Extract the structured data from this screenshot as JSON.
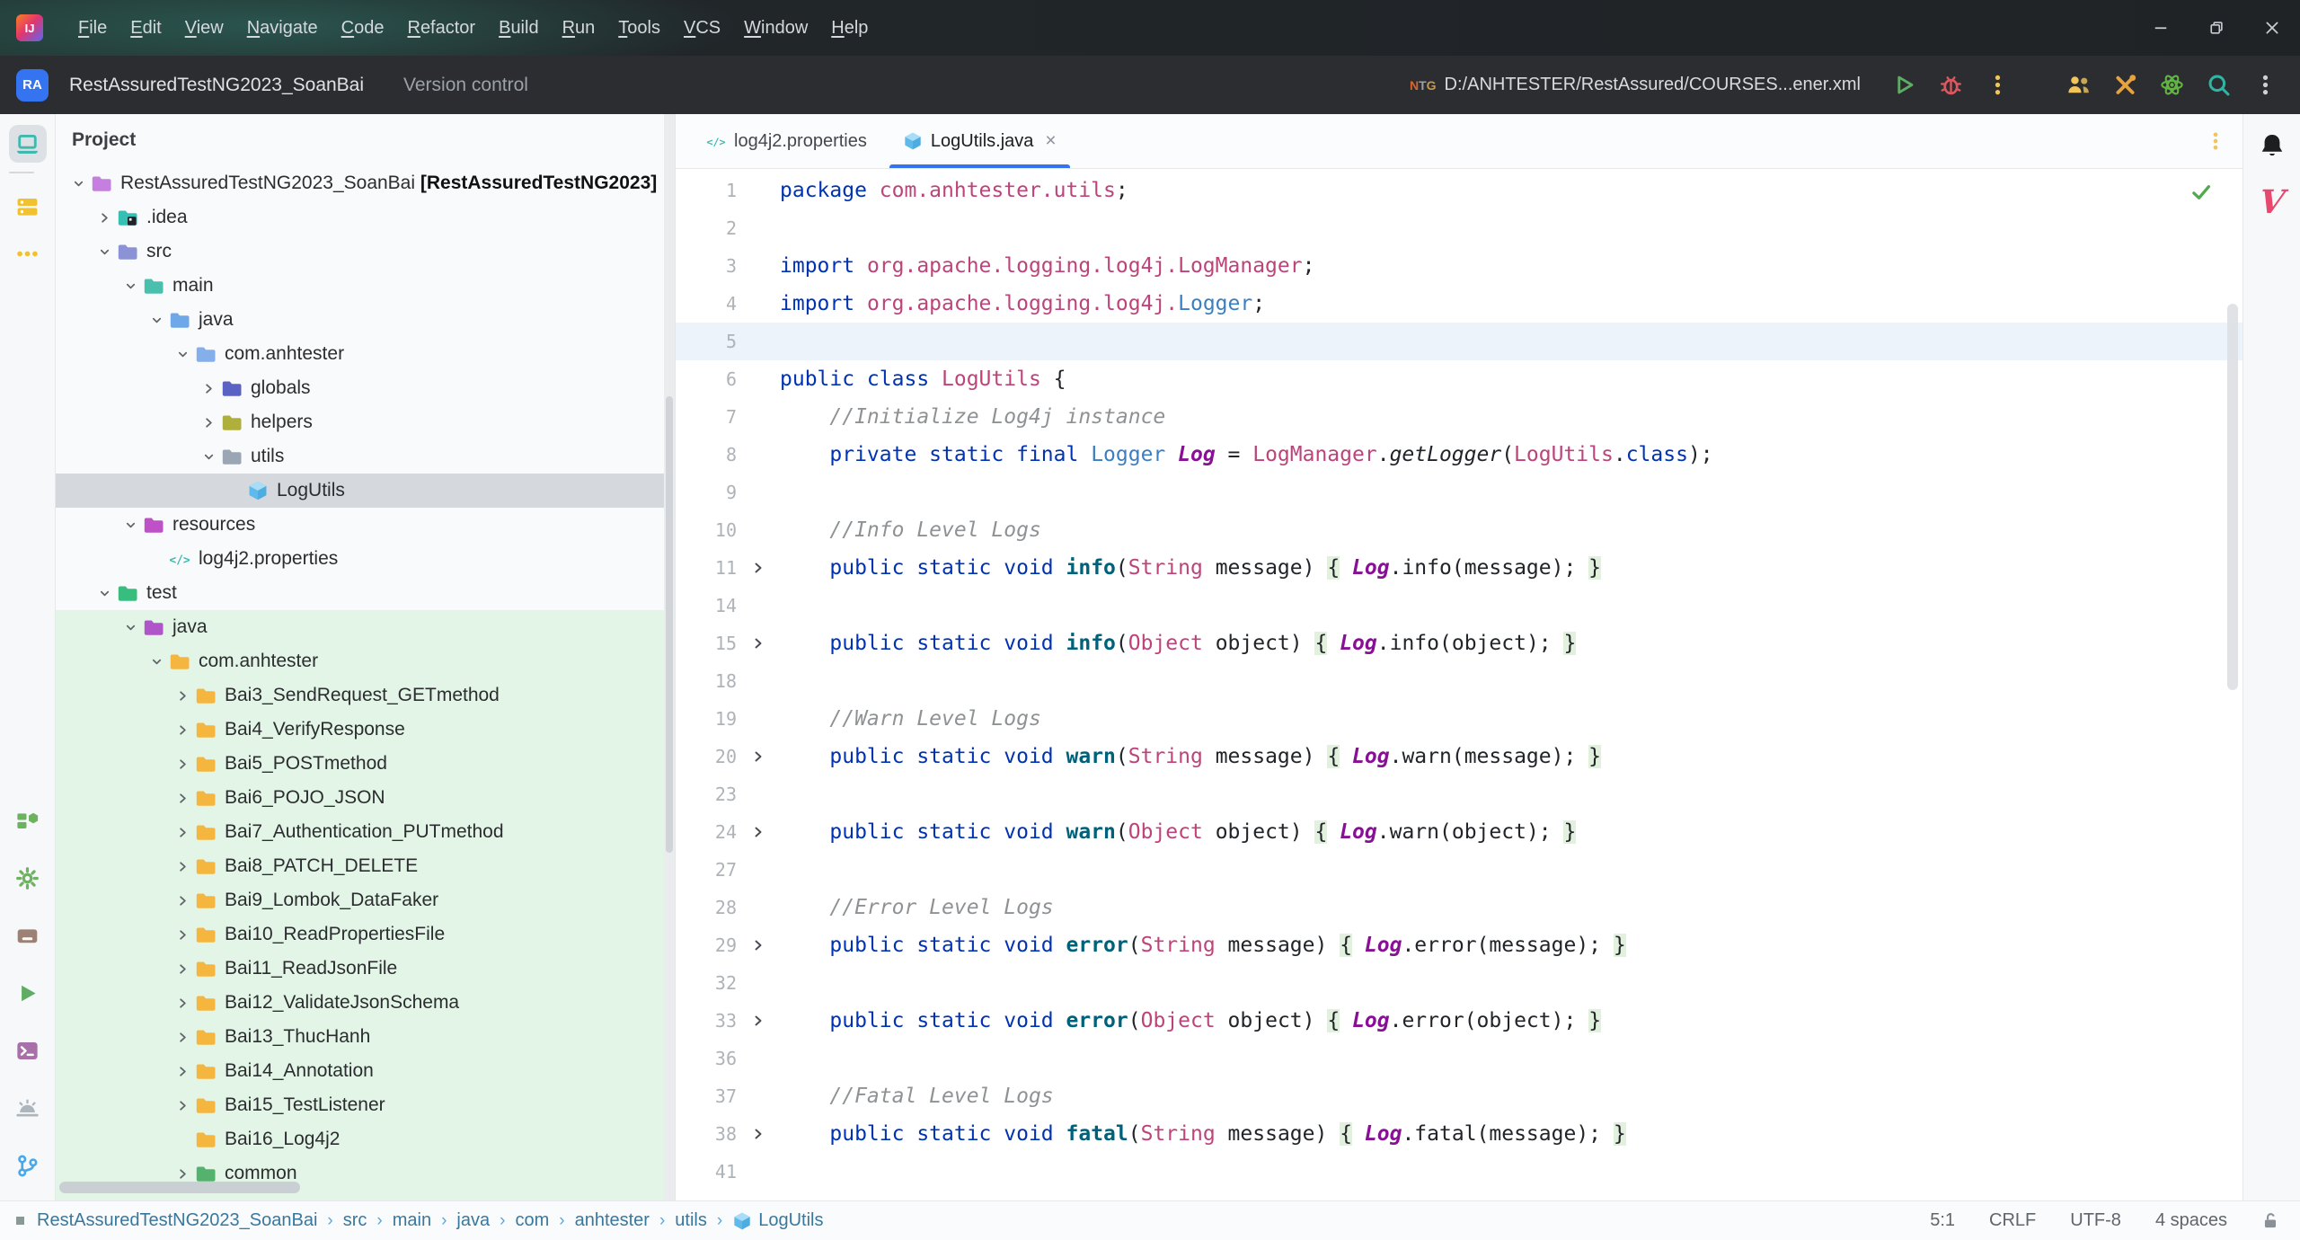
{
  "window": {
    "menus": [
      "File",
      "Edit",
      "View",
      "Navigate",
      "Code",
      "Refactor",
      "Build",
      "Run",
      "Tools",
      "VCS",
      "Window",
      "Help"
    ],
    "controls": [
      "minimize",
      "restore",
      "close"
    ],
    "logo_text": "IJ"
  },
  "toolbar": {
    "avatar": "RA",
    "project_name": "RestAssuredTestNG2023_SoanBai",
    "vcs_label": "Version control",
    "run_config": "D:/ANHTESTER/RestAssured/COURSES...ener.xml",
    "right_icons": [
      "users-icon",
      "tools-icon",
      "atom-icon",
      "search-icon",
      "kebab-icon"
    ]
  },
  "activity_bar": {
    "top": [
      {
        "name": "project-tool-icon",
        "glyph": "laptop",
        "color": "#3FB9AE",
        "selected": true
      },
      {
        "name": "commit-tool-icon",
        "glyph": "stack",
        "color": "#F0C232",
        "selected": false
      },
      {
        "name": "more-tools-icon",
        "glyph": "dots",
        "color": "#F0C232",
        "selected": false
      }
    ],
    "bottom": [
      {
        "name": "build-tool-icon",
        "glyph": "modules",
        "color": "#6DB35F"
      },
      {
        "name": "settings-icon",
        "glyph": "gear",
        "color": "#6DB35F"
      },
      {
        "name": "dependencies-tool-icon",
        "glyph": "box",
        "color": "#9C8275"
      },
      {
        "name": "run-tool-icon",
        "glyph": "play2",
        "color": "#5FAD65"
      },
      {
        "name": "terminal-tool-icon",
        "glyph": "terminal",
        "color": "#A86FA8"
      },
      {
        "name": "problems-tool-icon",
        "glyph": "alarm",
        "color": "#AEB6BD"
      },
      {
        "name": "git-tool-icon",
        "glyph": "branch",
        "color": "#4BA8E8"
      }
    ]
  },
  "project": {
    "header": "Project",
    "tree": [
      {
        "label": "RestAssuredTestNG2023_SoanBai",
        "suffix": " [RestAssuredTestNG2023]",
        "lvl": 0,
        "chev": "open",
        "icon": "folder",
        "color": "#C57FDE"
      },
      {
        "label": ".idea",
        "lvl": 1,
        "chev": "closed",
        "icon": "folder-idea",
        "color": "#35C0B4"
      },
      {
        "label": "src",
        "lvl": 1,
        "chev": "open",
        "icon": "folder",
        "color": "#8B93D6"
      },
      {
        "label": "main",
        "lvl": 2,
        "chev": "open",
        "icon": "folder",
        "color": "#49BFAE"
      },
      {
        "label": "java",
        "lvl": 3,
        "chev": "open",
        "icon": "folder",
        "color": "#6FA8E8"
      },
      {
        "label": "com.anhtester",
        "lvl": 4,
        "chev": "open",
        "icon": "folder",
        "color": "#85AFEA"
      },
      {
        "label": "globals",
        "lvl": 5,
        "chev": "closed",
        "icon": "folder",
        "color": "#5A62C4"
      },
      {
        "label": "helpers",
        "lvl": 5,
        "chev": "closed",
        "icon": "folder",
        "color": "#AFAF3C"
      },
      {
        "label": "utils",
        "lvl": 5,
        "chev": "open",
        "icon": "folder",
        "color": "#9AA6B4"
      },
      {
        "label": "LogUtils",
        "lvl": 6,
        "chev": "none",
        "icon": "cube",
        "selected": true
      },
      {
        "label": "resources",
        "lvl": 2,
        "chev": "open",
        "icon": "folder",
        "color": "#BE50C8"
      },
      {
        "label": "log4j2.properties",
        "lvl": 3,
        "chev": "none",
        "icon": "codetag"
      },
      {
        "label": "test",
        "lvl": 1,
        "chev": "open",
        "icon": "folder",
        "color": "#37BE7E"
      },
      {
        "label": "java",
        "lvl": 2,
        "chev": "open",
        "icon": "folder",
        "color": "#AF54C9",
        "green": true
      },
      {
        "label": "com.anhtester",
        "lvl": 3,
        "chev": "open",
        "icon": "folder",
        "color": "#F5B63F",
        "green": true
      },
      {
        "label": "Bai3_SendRequest_GETmethod",
        "lvl": 4,
        "chev": "closed",
        "icon": "folder",
        "color": "#F5B63F",
        "green": true
      },
      {
        "label": "Bai4_VerifyResponse",
        "lvl": 4,
        "chev": "closed",
        "icon": "folder",
        "color": "#F5B63F",
        "green": true
      },
      {
        "label": "Bai5_POSTmethod",
        "lvl": 4,
        "chev": "closed",
        "icon": "folder",
        "color": "#F5B63F",
        "green": true
      },
      {
        "label": "Bai6_POJO_JSON",
        "lvl": 4,
        "chev": "closed",
        "icon": "folder",
        "color": "#F5B63F",
        "green": true
      },
      {
        "label": "Bai7_Authentication_PUTmethod",
        "lvl": 4,
        "chev": "closed",
        "icon": "folder",
        "color": "#F5B63F",
        "green": true
      },
      {
        "label": "Bai8_PATCH_DELETE",
        "lvl": 4,
        "chev": "closed",
        "icon": "folder",
        "color": "#F5B63F",
        "green": true
      },
      {
        "label": "Bai9_Lombok_DataFaker",
        "lvl": 4,
        "chev": "closed",
        "icon": "folder",
        "color": "#F5B63F",
        "green": true
      },
      {
        "label": "Bai10_ReadPropertiesFile",
        "lvl": 4,
        "chev": "closed",
        "icon": "folder",
        "color": "#F5B63F",
        "green": true
      },
      {
        "label": "Bai11_ReadJsonFile",
        "lvl": 4,
        "chev": "closed",
        "icon": "folder",
        "color": "#F5B63F",
        "green": true
      },
      {
        "label": "Bai12_ValidateJsonSchema",
        "lvl": 4,
        "chev": "closed",
        "icon": "folder",
        "color": "#F5B63F",
        "green": true
      },
      {
        "label": "Bai13_ThucHanh",
        "lvl": 4,
        "chev": "closed",
        "icon": "folder",
        "color": "#F5B63F",
        "green": true
      },
      {
        "label": "Bai14_Annotation",
        "lvl": 4,
        "chev": "closed",
        "icon": "folder",
        "color": "#F5B63F",
        "green": true
      },
      {
        "label": "Bai15_TestListener",
        "lvl": 4,
        "chev": "closed",
        "icon": "folder",
        "color": "#F5B63F",
        "green": true
      },
      {
        "label": "Bai16_Log4j2",
        "lvl": 4,
        "chev": "none",
        "icon": "folder",
        "color": "#F5B63F",
        "green": true
      },
      {
        "label": "common",
        "lvl": 4,
        "chev": "closed",
        "icon": "folder",
        "color": "#54B26E",
        "green": true
      },
      {
        "label": "",
        "lvl": 4,
        "chev": "closed",
        "icon": "folder",
        "color": "#F5B63F",
        "green": true
      }
    ]
  },
  "editor": {
    "tabs": [
      {
        "label": "log4j2.properties",
        "icon": "codetag",
        "active": false,
        "closable": false
      },
      {
        "label": "LogUtils.java",
        "icon": "cube",
        "active": true,
        "closable": true,
        "close_glyph": "×"
      }
    ],
    "caret_line": 5,
    "inspection": "no problems found",
    "lines": [
      {
        "n": "1",
        "fold": false,
        "seg": [
          [
            "package ",
            "kw"
          ],
          [
            "com.anhtester.utils",
            "cls"
          ],
          [
            ";",
            "pl"
          ]
        ]
      },
      {
        "n": "2",
        "fold": false,
        "seg": []
      },
      {
        "n": "3",
        "fold": false,
        "seg": [
          [
            "import ",
            "kw"
          ],
          [
            "org.apache.logging.log4j.LogManager",
            "cls"
          ],
          [
            ";",
            "pl"
          ]
        ]
      },
      {
        "n": "4",
        "fold": false,
        "seg": [
          [
            "import ",
            "kw"
          ],
          [
            "org.apache.logging.log4j.",
            "cls"
          ],
          [
            "Logger",
            "ref"
          ],
          [
            ";",
            "pl"
          ]
        ]
      },
      {
        "n": "5",
        "fold": false,
        "seg": []
      },
      {
        "n": "6",
        "fold": false,
        "seg": [
          [
            "public class ",
            "kw"
          ],
          [
            "LogUtils",
            "cls"
          ],
          [
            " {",
            "pl"
          ]
        ]
      },
      {
        "n": "7",
        "fold": false,
        "seg": [
          [
            "    ",
            "pl"
          ],
          [
            "//Initialize Log4j instance",
            "cmt"
          ]
        ]
      },
      {
        "n": "8",
        "fold": false,
        "seg": [
          [
            "    ",
            "pl"
          ],
          [
            "private static final ",
            "kw"
          ],
          [
            "Logger ",
            "ref"
          ],
          [
            "Log",
            "fld"
          ],
          [
            " = ",
            "pl"
          ],
          [
            "LogManager",
            "cls"
          ],
          [
            ".",
            "pl"
          ],
          [
            "getLogger",
            "call"
          ],
          [
            "(",
            "pl"
          ],
          [
            "LogUtils",
            "cls"
          ],
          [
            ".",
            "pl"
          ],
          [
            "class",
            "kw"
          ],
          [
            ");",
            "pl"
          ]
        ]
      },
      {
        "n": "9",
        "fold": false,
        "seg": []
      },
      {
        "n": "10",
        "fold": false,
        "seg": [
          [
            "    ",
            "pl"
          ],
          [
            "//Info Level Logs",
            "cmt"
          ]
        ]
      },
      {
        "n": "11",
        "fold": true,
        "seg": [
          [
            "    ",
            "pl"
          ],
          [
            "public static void ",
            "kw"
          ],
          [
            "info",
            "mth"
          ],
          [
            "(",
            "pl"
          ],
          [
            "String",
            "cls"
          ],
          [
            " message",
            "pl"
          ],
          [
            ") ",
            "pl"
          ],
          [
            "{",
            "fb"
          ],
          [
            " ",
            "pl"
          ],
          [
            "Log",
            "fld"
          ],
          [
            ".info(",
            "pl"
          ],
          [
            "message",
            "pl"
          ],
          [
            "); ",
            "pl"
          ],
          [
            "}",
            "fb"
          ]
        ]
      },
      {
        "n": "14",
        "fold": false,
        "seg": []
      },
      {
        "n": "15",
        "fold": true,
        "seg": [
          [
            "    ",
            "pl"
          ],
          [
            "public static void ",
            "kw"
          ],
          [
            "info",
            "mth"
          ],
          [
            "(",
            "pl"
          ],
          [
            "Object",
            "cls"
          ],
          [
            " object",
            "pl"
          ],
          [
            ") ",
            "pl"
          ],
          [
            "{",
            "fb"
          ],
          [
            " ",
            "pl"
          ],
          [
            "Log",
            "fld"
          ],
          [
            ".info(",
            "pl"
          ],
          [
            "object",
            "pl"
          ],
          [
            "); ",
            "pl"
          ],
          [
            "}",
            "fb"
          ]
        ]
      },
      {
        "n": "18",
        "fold": false,
        "seg": []
      },
      {
        "n": "19",
        "fold": false,
        "seg": [
          [
            "    ",
            "pl"
          ],
          [
            "//Warn Level Logs",
            "cmt"
          ]
        ]
      },
      {
        "n": "20",
        "fold": true,
        "seg": [
          [
            "    ",
            "pl"
          ],
          [
            "public static void ",
            "kw"
          ],
          [
            "warn",
            "mth"
          ],
          [
            "(",
            "pl"
          ],
          [
            "String",
            "cls"
          ],
          [
            " message",
            "pl"
          ],
          [
            ") ",
            "pl"
          ],
          [
            "{",
            "fb"
          ],
          [
            " ",
            "pl"
          ],
          [
            "Log",
            "fld"
          ],
          [
            ".warn(",
            "pl"
          ],
          [
            "message",
            "pl"
          ],
          [
            "); ",
            "pl"
          ],
          [
            "}",
            "fb"
          ]
        ]
      },
      {
        "n": "23",
        "fold": false,
        "seg": []
      },
      {
        "n": "24",
        "fold": true,
        "seg": [
          [
            "    ",
            "pl"
          ],
          [
            "public static void ",
            "kw"
          ],
          [
            "warn",
            "mth"
          ],
          [
            "(",
            "pl"
          ],
          [
            "Object",
            "cls"
          ],
          [
            " object",
            "pl"
          ],
          [
            ") ",
            "pl"
          ],
          [
            "{",
            "fb"
          ],
          [
            " ",
            "pl"
          ],
          [
            "Log",
            "fld"
          ],
          [
            ".warn(",
            "pl"
          ],
          [
            "object",
            "pl"
          ],
          [
            "); ",
            "pl"
          ],
          [
            "}",
            "fb"
          ]
        ]
      },
      {
        "n": "27",
        "fold": false,
        "seg": []
      },
      {
        "n": "28",
        "fold": false,
        "seg": [
          [
            "    ",
            "pl"
          ],
          [
            "//Error Level Logs",
            "cmt"
          ]
        ]
      },
      {
        "n": "29",
        "fold": true,
        "seg": [
          [
            "    ",
            "pl"
          ],
          [
            "public static void ",
            "kw"
          ],
          [
            "error",
            "mth"
          ],
          [
            "(",
            "pl"
          ],
          [
            "String",
            "cls"
          ],
          [
            " message",
            "pl"
          ],
          [
            ") ",
            "pl"
          ],
          [
            "{",
            "fb"
          ],
          [
            " ",
            "pl"
          ],
          [
            "Log",
            "fld"
          ],
          [
            ".error(",
            "pl"
          ],
          [
            "message",
            "pl"
          ],
          [
            "); ",
            "pl"
          ],
          [
            "}",
            "fb"
          ]
        ]
      },
      {
        "n": "32",
        "fold": false,
        "seg": []
      },
      {
        "n": "33",
        "fold": true,
        "seg": [
          [
            "    ",
            "pl"
          ],
          [
            "public static void ",
            "kw"
          ],
          [
            "error",
            "mth"
          ],
          [
            "(",
            "pl"
          ],
          [
            "Object",
            "cls"
          ],
          [
            " object",
            "pl"
          ],
          [
            ") ",
            "pl"
          ],
          [
            "{",
            "fb"
          ],
          [
            " ",
            "pl"
          ],
          [
            "Log",
            "fld"
          ],
          [
            ".error(",
            "pl"
          ],
          [
            "object",
            "pl"
          ],
          [
            "); ",
            "pl"
          ],
          [
            "}",
            "fb"
          ]
        ]
      },
      {
        "n": "36",
        "fold": false,
        "seg": []
      },
      {
        "n": "37",
        "fold": false,
        "seg": [
          [
            "    ",
            "pl"
          ],
          [
            "//Fatal Level Logs",
            "cmt"
          ]
        ]
      },
      {
        "n": "38",
        "fold": true,
        "seg": [
          [
            "    ",
            "pl"
          ],
          [
            "public static void ",
            "kw"
          ],
          [
            "fatal",
            "mth"
          ],
          [
            "(",
            "pl"
          ],
          [
            "String",
            "cls"
          ],
          [
            " message",
            "pl"
          ],
          [
            ") ",
            "pl"
          ],
          [
            "{",
            "fb"
          ],
          [
            " ",
            "pl"
          ],
          [
            "Log",
            "fld"
          ],
          [
            ".fatal(",
            "pl"
          ],
          [
            "message",
            "pl"
          ],
          [
            "); ",
            "pl"
          ],
          [
            "}",
            "fb"
          ]
        ]
      },
      {
        "n": "41",
        "fold": false,
        "seg": []
      }
    ]
  },
  "right_stripe": {
    "icons": [
      "notifications-bell-icon",
      "v-plugin-icon"
    ],
    "v_plugin_text": "V"
  },
  "status_bar": {
    "breadcrumbs": [
      "RestAssuredTestNG2023_SoanBai",
      "src",
      "main",
      "java",
      "com",
      "anhtester",
      "utils",
      "LogUtils"
    ],
    "separator": "›",
    "right": [
      "5:1",
      "CRLF",
      "UTF-8",
      "4 spaces"
    ]
  },
  "colors": {
    "accent_blue": "#3574F0",
    "keyword": "#0033B3",
    "class_ref_pink": "#BD447A",
    "type_blue": "#3C7FC0",
    "static_field_purple": "#871094",
    "method_teal": "#00627A",
    "comment_gray": "#8E9294",
    "test_source_green": "#E3F5E6",
    "selection_gray": "#D5D9DE",
    "caret_line": "#EDF3FB",
    "titlebar_dark": "#1F2326",
    "toolbar_dark": "#2B2D30",
    "run_green": "#5FAD65",
    "debug_red": "#DB5860",
    "warning_yellow": "#F2C55C"
  }
}
